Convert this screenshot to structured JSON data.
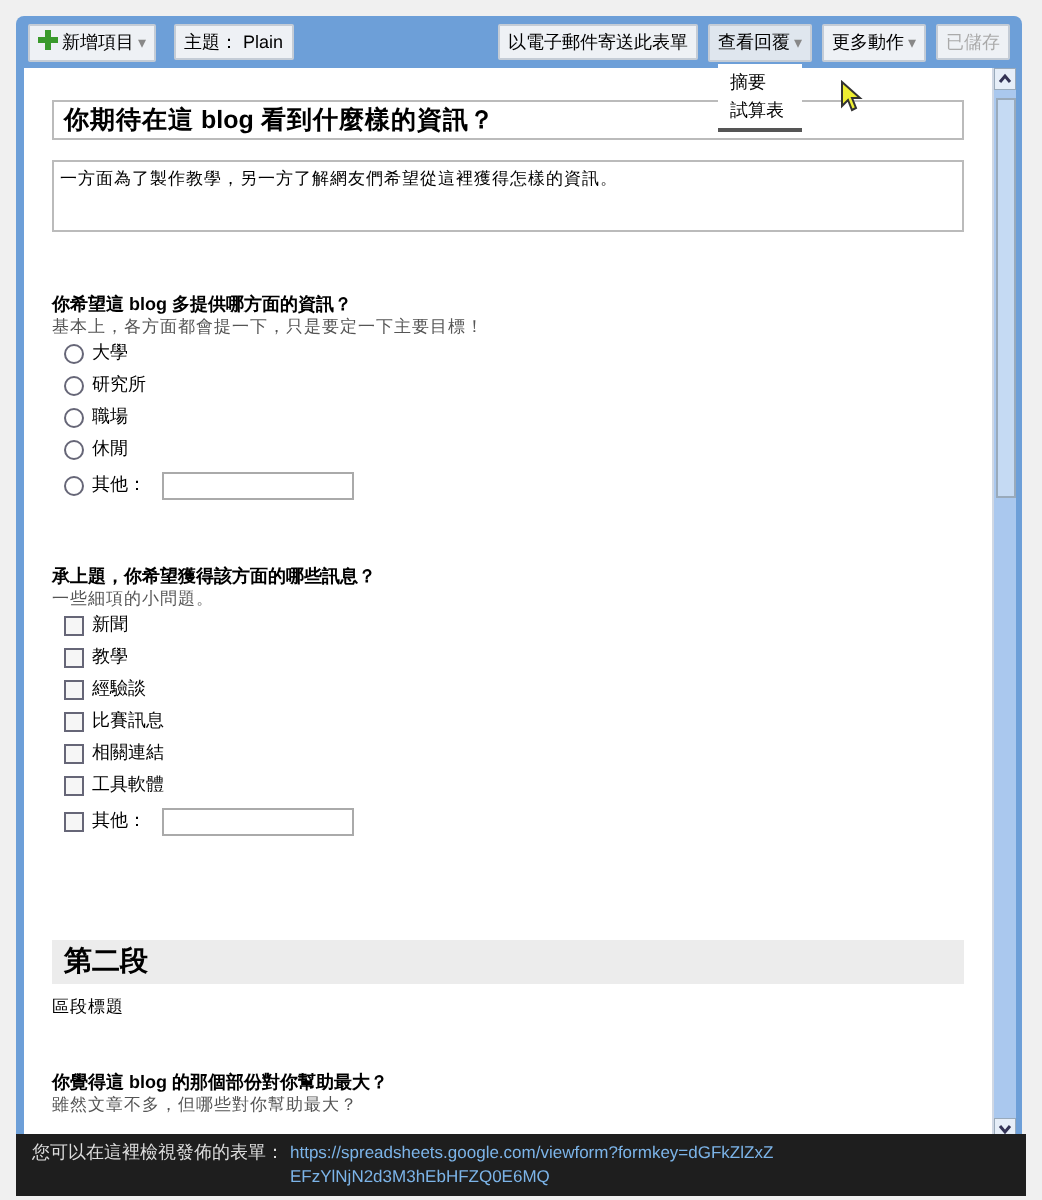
{
  "toolbar": {
    "add_item": "新增項目",
    "add_caret": "▾",
    "theme_label": "主題：",
    "theme_value": "Plain",
    "buttons": [
      {
        "label": "以電子郵件寄送此表單",
        "disabled": false,
        "expanded": false
      },
      {
        "label": "查看回覆",
        "caret": "▾",
        "disabled": false,
        "expanded": true
      },
      {
        "label": "更多動作",
        "caret": "▾",
        "disabled": false,
        "expanded": false
      },
      {
        "label": "已儲存",
        "disabled": true,
        "expanded": false
      }
    ]
  },
  "dropdown_menu": [
    "摘要",
    "試算表"
  ],
  "form": {
    "title": "你期待在這 blog 看到什麼樣的資訊？",
    "description": "一方面為了製作教學，另一方了解網友們希望從這裡獲得怎樣的資訊。",
    "items": [
      {
        "kind": "radio",
        "title": "你希望這 blog 多提供哪方面的資訊？",
        "help": "基本上，各方面都會提一下，只是要定一下主要目標！",
        "options": [
          {
            "label": "大學",
            "checked": false
          },
          {
            "label": "研究所",
            "checked": false
          },
          {
            "label": "職場",
            "checked": false
          },
          {
            "label": "休閒",
            "checked": false
          },
          {
            "label": "其他：",
            "checked": false,
            "other": true
          }
        ]
      },
      {
        "kind": "checkbox",
        "title": "承上題，你希望獲得該方面的哪些訊息？",
        "help": "一些細項的小問題。",
        "options": [
          {
            "label": "新聞",
            "checked": false
          },
          {
            "label": "教學",
            "checked": false
          },
          {
            "label": "經驗談",
            "checked": false
          },
          {
            "label": "比賽訊息",
            "checked": false
          },
          {
            "label": "相關連結",
            "checked": false
          },
          {
            "label": "工具軟體",
            "checked": false
          },
          {
            "label": "其他：",
            "checked": false,
            "other": true
          }
        ]
      },
      {
        "kind": "section",
        "title": "第二段",
        "help": "區段標題"
      },
      {
        "kind": "text",
        "title": "你覺得這 blog 的那個部份對你幫助最大？",
        "help": "雖然文章不多，但哪些對你幫助最大？"
      }
    ]
  },
  "footer": {
    "text": "您可以在這裡檢視發佈的表單：",
    "link": "https://spreadsheets.google.com/viewform?formkey=dGFkZlZxZEFzYlNjN2d3M3hEbHFZQ0E6MQ"
  }
}
